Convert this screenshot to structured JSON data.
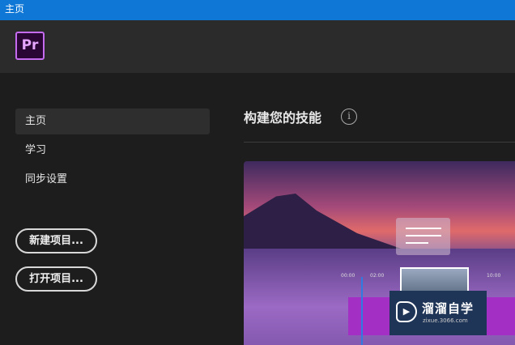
{
  "window": {
    "title": "主页"
  },
  "app": {
    "logo": "Pr"
  },
  "sidebar": {
    "items": [
      {
        "label": "主页",
        "active": true
      },
      {
        "label": "学习"
      },
      {
        "label": "同步设置"
      }
    ],
    "buttons": {
      "new_project": "新建项目...",
      "open_project": "打开项目..."
    }
  },
  "main": {
    "section_title": "构建您的技能",
    "info_icon": "i",
    "hero": {
      "timestamps": [
        "00:00",
        "02:00",
        "10:00"
      ]
    }
  },
  "watermark": {
    "title": "溜溜自学",
    "subtitle": "zixue.3066.com"
  }
}
